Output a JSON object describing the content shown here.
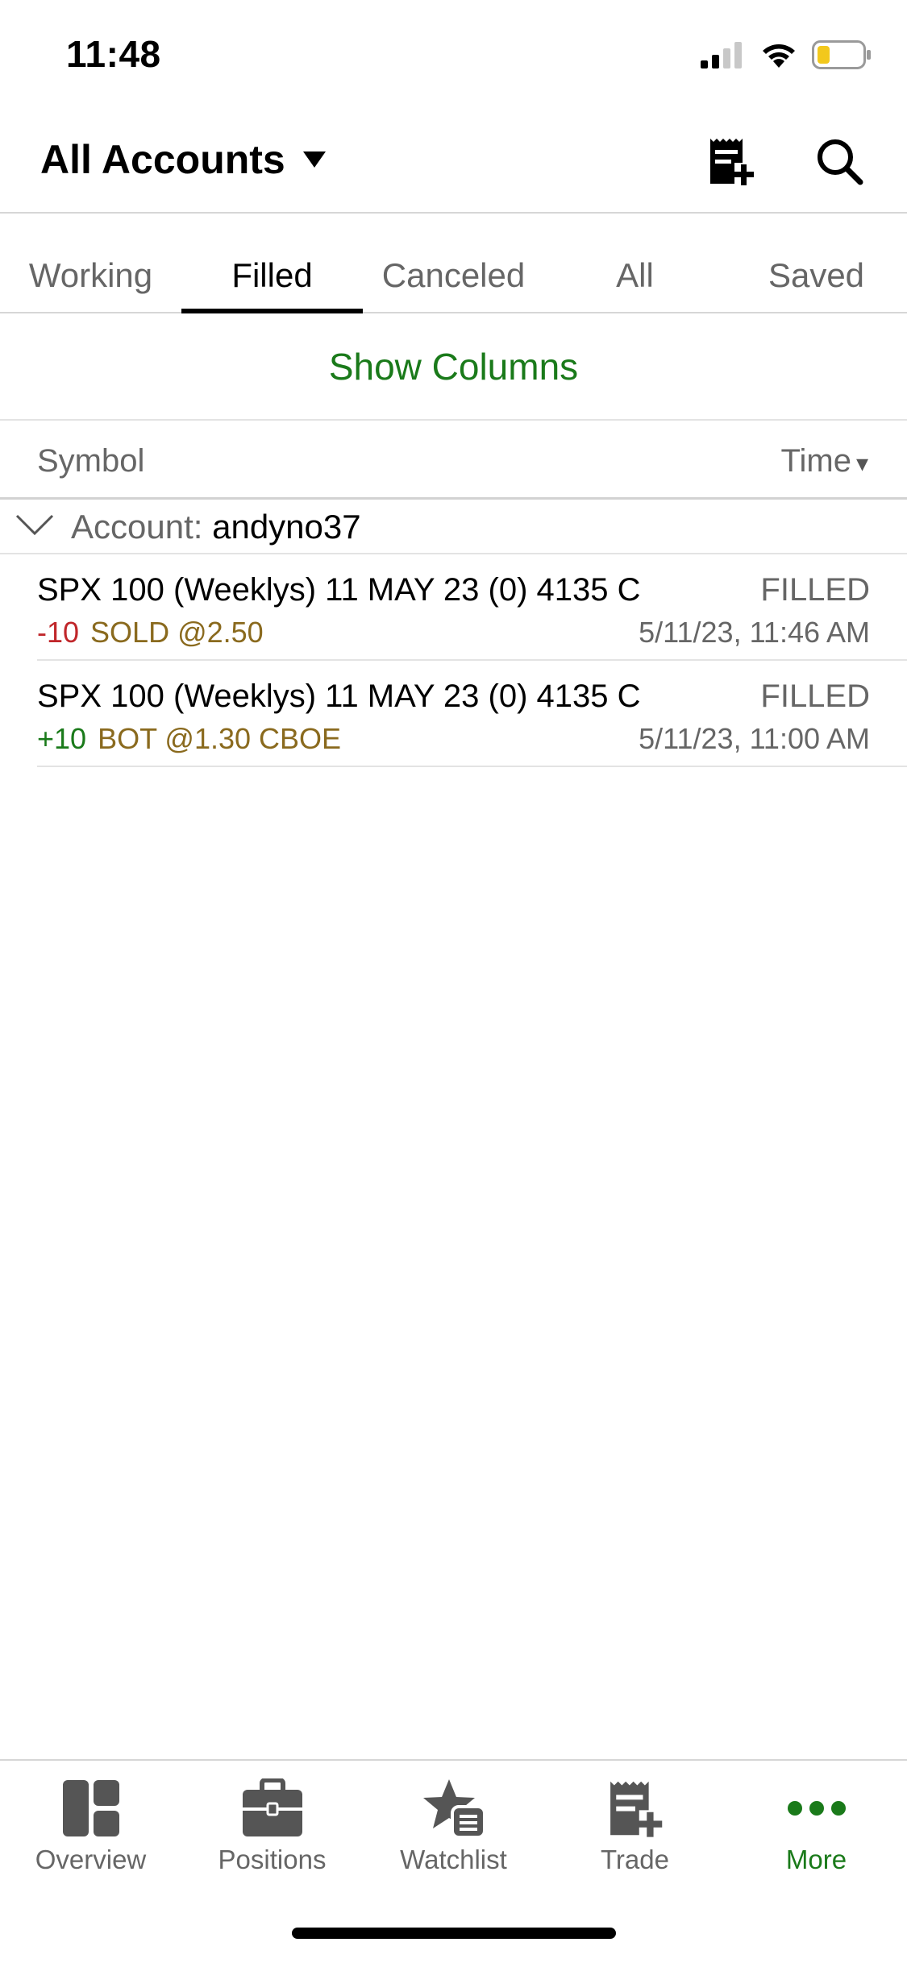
{
  "status_bar": {
    "time": "11:48",
    "battery_color": "#f2c81c"
  },
  "header": {
    "title": "All Accounts",
    "icons": [
      "new-order-icon",
      "search-icon"
    ]
  },
  "tabs": [
    {
      "label": "Working",
      "active": false
    },
    {
      "label": "Filled",
      "active": true
    },
    {
      "label": "Canceled",
      "active": false
    },
    {
      "label": "All",
      "active": false
    },
    {
      "label": "Saved",
      "active": false
    }
  ],
  "show_columns_label": "Show Columns",
  "columns": {
    "symbol": "Symbol",
    "time": "Time",
    "sort_indicator": "▾"
  },
  "account_group": {
    "label": "Account:",
    "name": "andyno37"
  },
  "orders": [
    {
      "symbol": "SPX 100 (Weeklys) 11 MAY 23 (0) 4135 C",
      "status": "FILLED",
      "qty": "-10",
      "action": "SOLD @2.50",
      "time": "5/11/23, 11:46 AM"
    },
    {
      "symbol": "SPX 100 (Weeklys) 11 MAY 23 (0) 4135 C",
      "status": "FILLED",
      "qty": "+10",
      "action": "BOT @1.30 CBOE",
      "time": "5/11/23, 11:00 AM"
    }
  ],
  "tabbar": [
    {
      "label": "Overview",
      "icon": "overview-icon",
      "active": false
    },
    {
      "label": "Positions",
      "icon": "briefcase-icon",
      "active": false
    },
    {
      "label": "Watchlist",
      "icon": "watchlist-star-icon",
      "active": false
    },
    {
      "label": "Trade",
      "icon": "trade-ticket-icon",
      "active": false
    },
    {
      "label": "More",
      "icon": "more-dots-icon",
      "active": true
    }
  ],
  "colors": {
    "accent_green": "#1a7a1a",
    "negative_red": "#c0262a",
    "action_gold": "#8a6a1e"
  }
}
